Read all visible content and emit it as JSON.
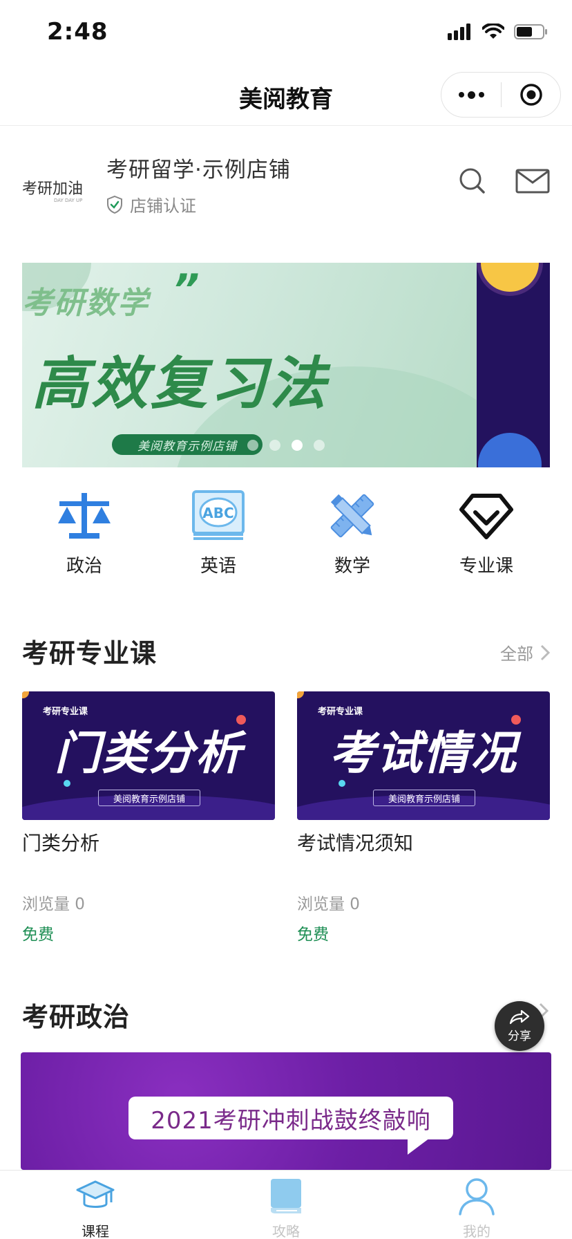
{
  "status_bar": {
    "time": "2:48"
  },
  "nav": {
    "title": "美阅教育"
  },
  "shop": {
    "logo_text": "考研加油",
    "logo_sub": "DAY DAY UP",
    "name": "考研留学·示例店铺",
    "cert_label": "店铺认证"
  },
  "banner": {
    "subtitle": "考研数学",
    "quote_mark": "”",
    "title": "高效复习法",
    "tag": "美阅教育示例店铺",
    "dots_count": 4,
    "active_dot": 2
  },
  "categories": [
    {
      "label": "政治",
      "icon": "scale-icon"
    },
    {
      "label": "英语",
      "icon": "abc-book-icon"
    },
    {
      "label": "数学",
      "icon": "ruler-pencil-icon"
    },
    {
      "label": "专业课",
      "icon": "diamond-icon"
    }
  ],
  "section_major": {
    "title": "考研专业课",
    "more_label": "全部",
    "courses": [
      {
        "kicker": "考研专业课",
        "cover_text": "门类分析",
        "cover_tag": "美阅教育示例店铺",
        "title": "门类分析",
        "views": "浏览量 0",
        "price": "免费"
      },
      {
        "kicker": "考研专业课",
        "cover_text": "考试情况",
        "cover_tag": "美阅教育示例店铺",
        "title": "考试情况须知",
        "views": "浏览量 0",
        "price": "免费"
      }
    ]
  },
  "section_politics": {
    "title": "考研政治",
    "banner_text": "2021考研冲刺战鼓终敲响"
  },
  "share": {
    "label": "分享"
  },
  "tab_bar": {
    "tabs": [
      {
        "label": "课程",
        "icon": "graduation-cap-icon",
        "active": true
      },
      {
        "label": "攻略",
        "icon": "book-icon",
        "active": false
      },
      {
        "label": "我的",
        "icon": "user-icon",
        "active": false
      }
    ]
  },
  "colors": {
    "accent_green": "#1f8f55",
    "tab_active_icon": "#4aa3e0",
    "tab_inactive_icon": "#8fcbee",
    "category_blue": "#2f7fe0"
  }
}
